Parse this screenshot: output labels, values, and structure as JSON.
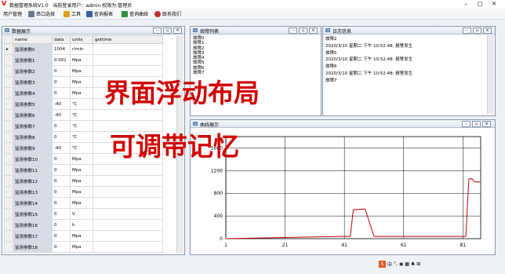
{
  "window": {
    "title": "数据管理系统V1.0",
    "user_info": "当前登录用户：admin 权限为:管理员",
    "logo": "V"
  },
  "menu": [
    {
      "label": "用户管理"
    },
    {
      "label": "串口选择"
    },
    {
      "label": "工具"
    },
    {
      "label": "查询报表"
    },
    {
      "label": "查询曲线"
    },
    {
      "label": "联系我们"
    }
  ],
  "data_panel": {
    "title": "数据展示",
    "columns": [
      "name",
      "data",
      "units",
      "gettime"
    ],
    "rows": [
      {
        "name": "监测参数0",
        "data": "1004",
        "units": "r/min",
        "gettime": ""
      },
      {
        "name": "监测参数1",
        "data": "0.001",
        "units": "Mpa",
        "gettime": ""
      },
      {
        "name": "监测参数2",
        "data": "0",
        "units": "Mpa",
        "gettime": ""
      },
      {
        "name": "监测参数3",
        "data": "0",
        "units": "Mpa",
        "gettime": ""
      },
      {
        "name": "监测参数4",
        "data": "0",
        "units": "Mpa",
        "gettime": ""
      },
      {
        "name": "监测参数5",
        "data": "-40",
        "units": "℃",
        "gettime": ""
      },
      {
        "name": "监测参数6",
        "data": "-40",
        "units": "℃",
        "gettime": ""
      },
      {
        "name": "监测参数7",
        "data": "0",
        "units": "℃",
        "gettime": ""
      },
      {
        "name": "监测参数8",
        "data": "0",
        "units": "℃",
        "gettime": ""
      },
      {
        "name": "监测参数9",
        "data": "-40",
        "units": "℃",
        "gettime": ""
      },
      {
        "name": "监测参数10",
        "data": "0",
        "units": "Mpa",
        "gettime": ""
      },
      {
        "name": "监测参数11",
        "data": "0",
        "units": "Mpa",
        "gettime": ""
      },
      {
        "name": "监测参数12",
        "data": "0",
        "units": "Mpa",
        "gettime": ""
      },
      {
        "name": "监测参数13",
        "data": "0",
        "units": "Mpa",
        "gettime": ""
      },
      {
        "name": "监测参数14",
        "data": "0",
        "units": "Mpa",
        "gettime": ""
      },
      {
        "name": "监测参数15",
        "data": "0",
        "units": "V",
        "gettime": ""
      },
      {
        "name": "监测参数16",
        "data": "0",
        "units": "h",
        "gettime": ""
      },
      {
        "name": "监测参数17",
        "data": "0",
        "units": "Mpa",
        "gettime": ""
      },
      {
        "name": "监测参数18",
        "data": "0",
        "units": "Mpa",
        "gettime": ""
      }
    ]
  },
  "fault_panel": {
    "title": "故障列表",
    "items": [
      "故障0",
      "故障1",
      "故障2",
      "故障3",
      "故障4",
      "故障5",
      "故障6",
      "故障7"
    ]
  },
  "log_panel": {
    "title": "日志信息",
    "lines": [
      "故障2",
      "2020/3/10 星期二 下午 10:52:48: 报警发生",
      "故障5",
      "2020/3/10 星期二 下午 10:52:48: 报警发生",
      "故障6",
      "2020/3/10 星期二 下午 10:52:48: 报警发生",
      "故障7"
    ]
  },
  "curve_panel": {
    "title": "曲线展示"
  },
  "overlay": {
    "line1": "界面浮动布局",
    "line2": "可调带记忆"
  },
  "taskbar": {
    "label": "中"
  },
  "colors": {
    "line": "#c00000",
    "overlay": "#d10000"
  },
  "chart_data": {
    "type": "line",
    "x": [
      1,
      40,
      43,
      44,
      47,
      48,
      51,
      62,
      63,
      64,
      82,
      83,
      84,
      85,
      87
    ],
    "values": [
      0,
      40,
      40,
      510,
      520,
      520,
      40,
      40,
      40,
      40,
      40,
      1050,
      1060,
      1000,
      1000
    ],
    "xticks": [
      1,
      21,
      41,
      61,
      81
    ],
    "yticks": [
      0,
      400,
      800,
      1200,
      1600
    ],
    "xlim": [
      1,
      87
    ],
    "ylim": [
      0,
      1800
    ],
    "grid": true
  }
}
